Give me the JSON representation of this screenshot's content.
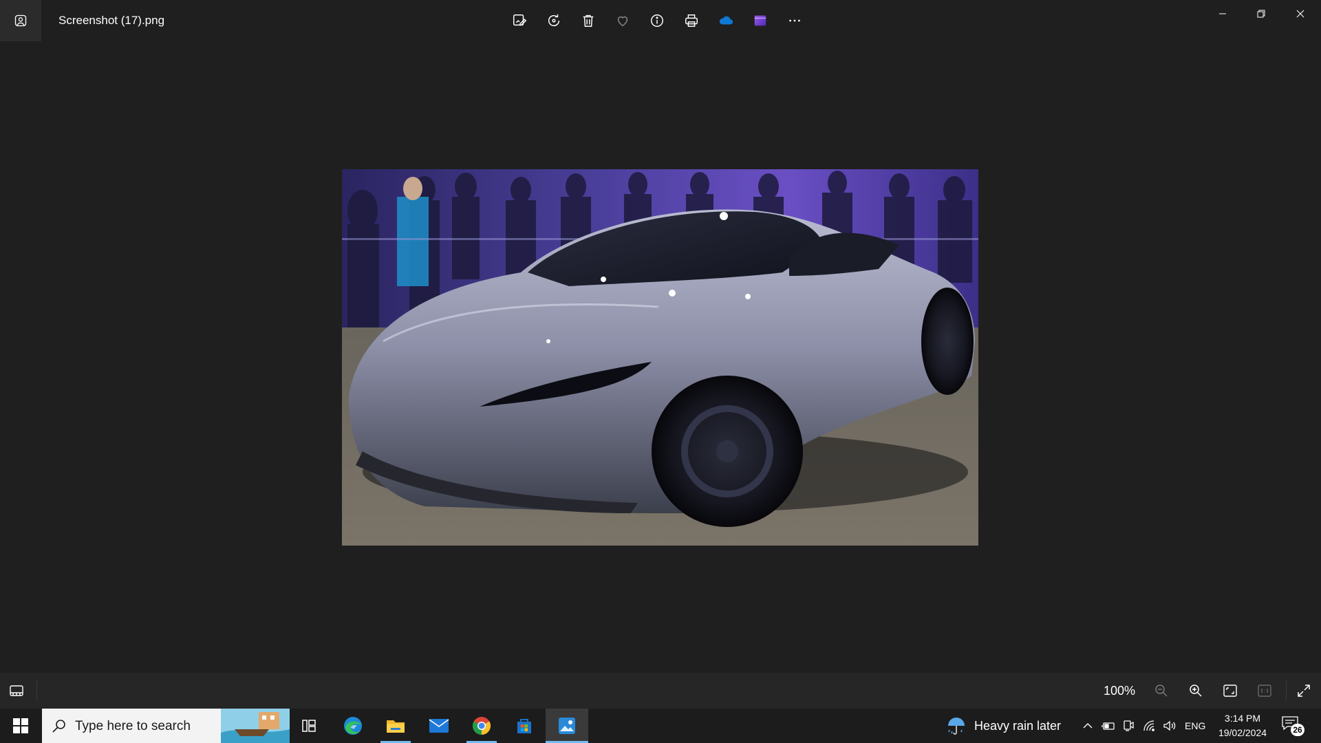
{
  "window": {
    "title": "Screenshot (17).png",
    "minimize_label": "Minimize",
    "restore_label": "Restore",
    "close_label": "Close"
  },
  "toolbar": {
    "items": [
      {
        "icon": "edit-image-icon",
        "label": "Edit & Create"
      },
      {
        "icon": "rotate-icon",
        "label": "Rotate"
      },
      {
        "icon": "delete-icon",
        "label": "Delete"
      },
      {
        "icon": "favorite-heart-icon",
        "label": "Favorite"
      },
      {
        "icon": "info-icon",
        "label": "File info"
      },
      {
        "icon": "print-icon",
        "label": "Print"
      },
      {
        "icon": "onedrive-cloud-icon",
        "label": "OneDrive"
      },
      {
        "icon": "clipchamp-icon",
        "label": "Clipchamp"
      },
      {
        "icon": "more-options-icon",
        "label": "See more"
      }
    ]
  },
  "image": {
    "subject": "silver sports car at event"
  },
  "bottombar": {
    "zoom": "100%",
    "buttons": [
      "filmstrip-icon",
      "zoom-out-icon",
      "zoom-in-icon",
      "fit-to-window-icon",
      "actual-size-icon",
      "fullscreen-icon"
    ]
  },
  "taskbar": {
    "search_placeholder": "Type here to search",
    "apps": [
      {
        "name": "task-view",
        "running": false
      },
      {
        "name": "microsoft-edge",
        "running": false
      },
      {
        "name": "file-explorer",
        "running": true
      },
      {
        "name": "mail",
        "running": false
      },
      {
        "name": "google-chrome",
        "running": true
      },
      {
        "name": "microsoft-store",
        "running": false
      },
      {
        "name": "photos",
        "running": true,
        "active": true
      }
    ],
    "weather": "Heavy rain later",
    "language": "ENG",
    "time": "3:14 PM",
    "date": "19/02/2024",
    "notification_count": "26"
  },
  "colors": {
    "background": "#1f1f1f",
    "taskbar": "#1c1c1c",
    "accent": "#76b9ed",
    "onedrive": "#0f78d4",
    "clipchamp": "#7b4fd6"
  }
}
